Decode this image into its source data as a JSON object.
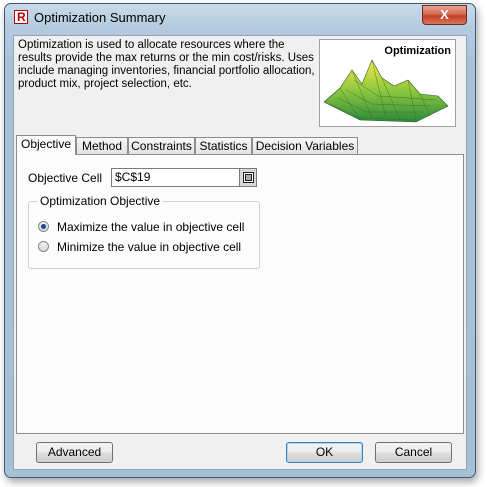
{
  "window": {
    "title": "Optimization Summary",
    "app_icon_letter": "R",
    "close_symbol": "X"
  },
  "description": "Optimization is used to allocate resources where the results provide the max returns or the min cost/risks. Uses include managing inventories, financial portfolio allocation, product mix, project selection, etc.",
  "banner": {
    "label": "Optimization",
    "icon": "3d-surface-plot-image"
  },
  "tabs": [
    {
      "label": "Objective",
      "active": true
    },
    {
      "label": "Method",
      "active": false
    },
    {
      "label": "Constraints",
      "active": false
    },
    {
      "label": "Statistics",
      "active": false
    },
    {
      "label": "Decision Variables",
      "active": false
    }
  ],
  "objective": {
    "cell_label": "Objective Cell",
    "cell_value": "$C$19",
    "group_label": "Optimization Objective",
    "options": [
      {
        "label": "Maximize the value in objective cell",
        "checked": true
      },
      {
        "label": "Minimize the value in objective cell",
        "checked": false
      }
    ]
  },
  "buttons": {
    "advanced": "Advanced",
    "ok": "OK",
    "cancel": "Cancel"
  },
  "colors": {
    "accent": "#1b4d8f",
    "close_button": "#c33f26"
  }
}
